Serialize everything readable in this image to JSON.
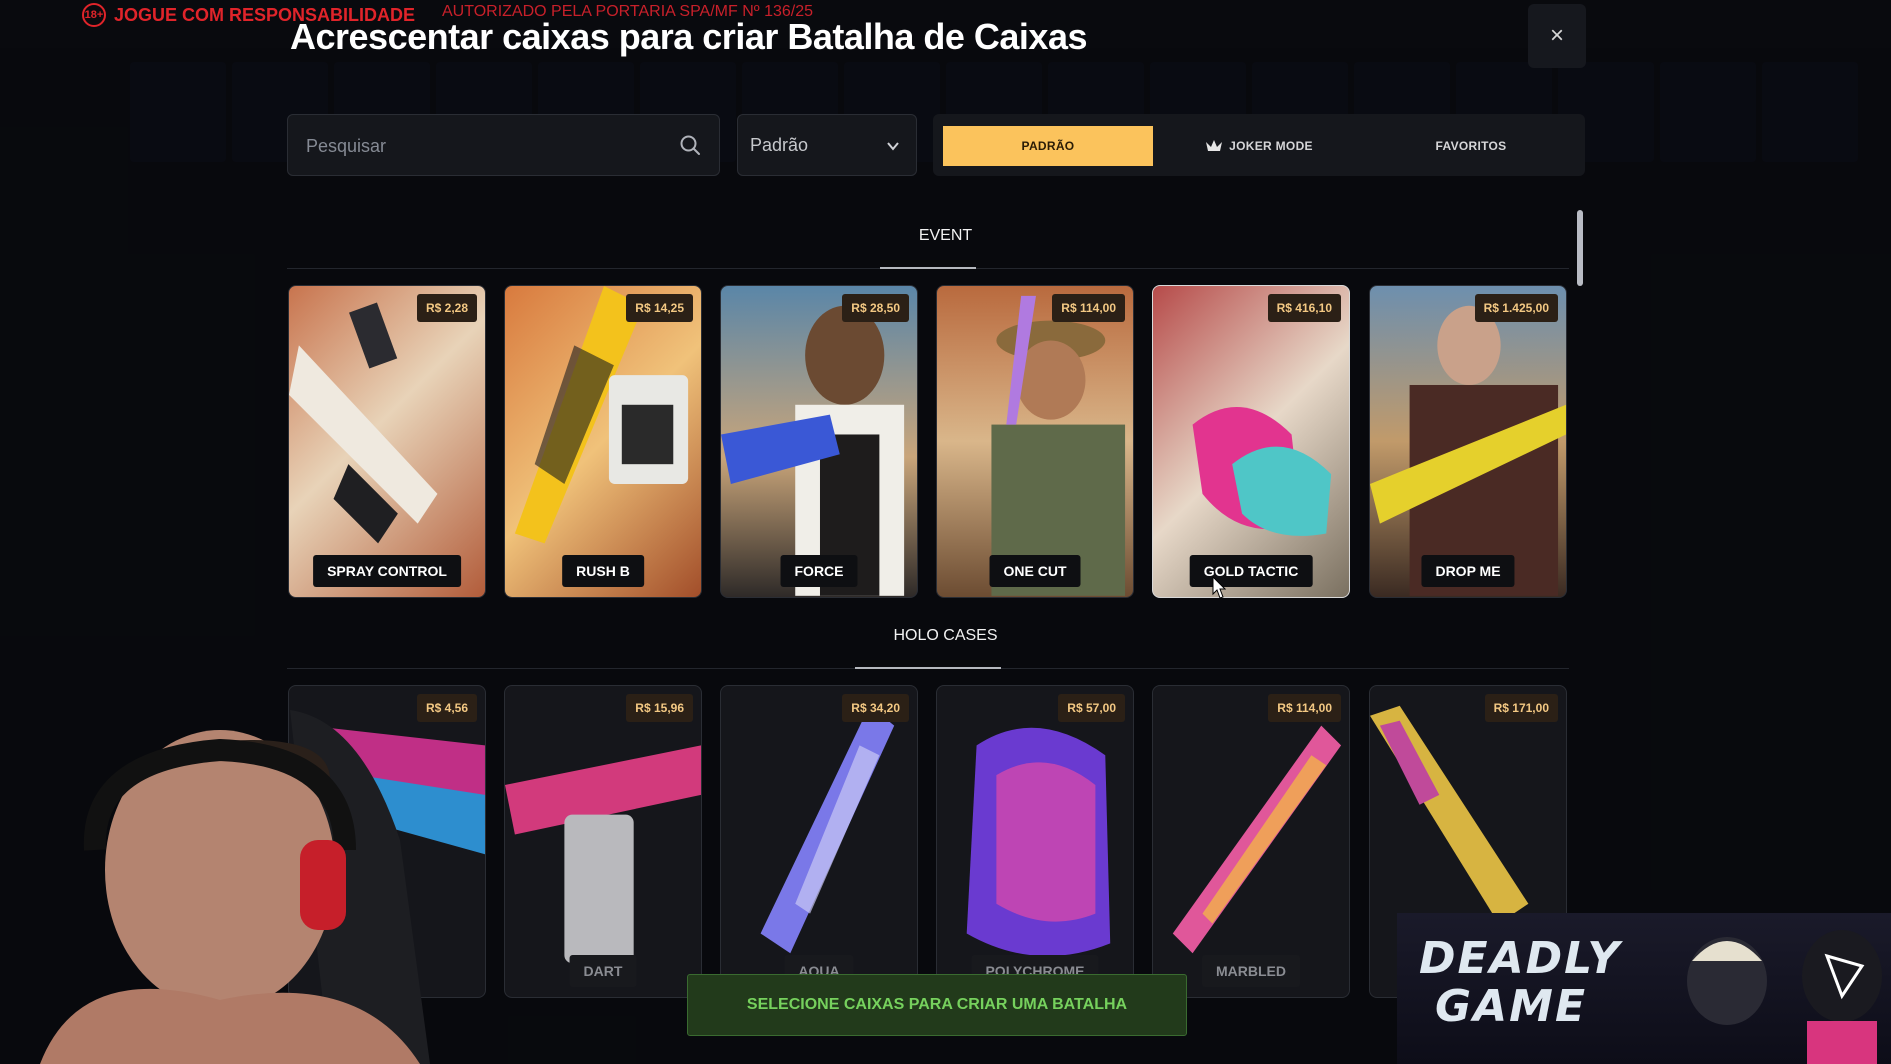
{
  "banner": {
    "age_badge": "18+",
    "responsibility": "JOGUE COM RESPONSABILIDADE",
    "authorization": "AUTORIZADO PELA PORTARIA SPA/MF Nº 136/25"
  },
  "modal": {
    "title": "Acrescentar caixas para criar Batalha de Caixas",
    "close_symbol": "×"
  },
  "filters": {
    "search_placeholder": "Pesquisar",
    "sort_value": "Padrão",
    "modes": [
      {
        "label": "PADRÃO",
        "active": true
      },
      {
        "label": "JOKER MODE",
        "active": false
      },
      {
        "label": "FAVORITOS",
        "active": false
      }
    ]
  },
  "sections": [
    {
      "title": "EVENT",
      "cards": [
        {
          "name": "SPRAY CONTROL",
          "price": "R$ 2,28"
        },
        {
          "name": "RUSH B",
          "price": "R$ 14,25"
        },
        {
          "name": "FORCE",
          "price": "R$ 28,50"
        },
        {
          "name": "ONE CUT",
          "price": "R$ 114,00"
        },
        {
          "name": "GOLD TACTIC",
          "price": "R$ 416,10"
        },
        {
          "name": "DROP ME",
          "price": "R$ 1.425,00"
        }
      ]
    },
    {
      "title": "HOLO CASES",
      "cards": [
        {
          "name": "",
          "price": "R$ 4,56"
        },
        {
          "name": "DART",
          "price": "R$ 15,96"
        },
        {
          "name": "AQUA",
          "price": "R$ 34,20"
        },
        {
          "name": "POLYCHROME",
          "price": "R$ 57,00"
        },
        {
          "name": "MARBLED",
          "price": "R$ 114,00"
        },
        {
          "name": "",
          "price": "R$ 171,00"
        }
      ]
    }
  ],
  "cta": {
    "label": "SELECIONE CAIXAS PARA CRIAR UMA BATALHA"
  },
  "overlay_logo": {
    "line1": "DEADLY",
    "line2": "GAME"
  },
  "colors": {
    "accent": "#fbc35c",
    "cta_text": "#76d15d",
    "warning": "#e0242a"
  }
}
